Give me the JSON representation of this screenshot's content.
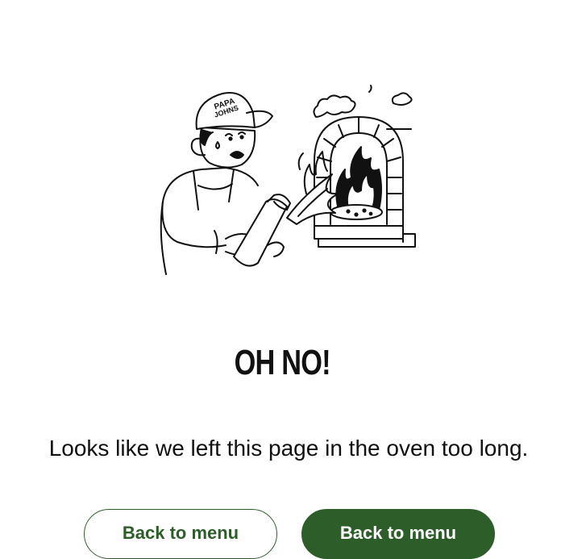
{
  "illustration": {
    "cap_text_line1": "PAPA",
    "cap_text_line2": "JOHNS"
  },
  "heading": "OH NO!",
  "message": "Looks like we left this page in the oven too long.",
  "buttons": {
    "secondary_label": "Back to menu",
    "primary_label": "Back to menu"
  },
  "colors": {
    "brand_green": "#2d5e2a",
    "text": "#111111",
    "background": "#ffffff"
  }
}
